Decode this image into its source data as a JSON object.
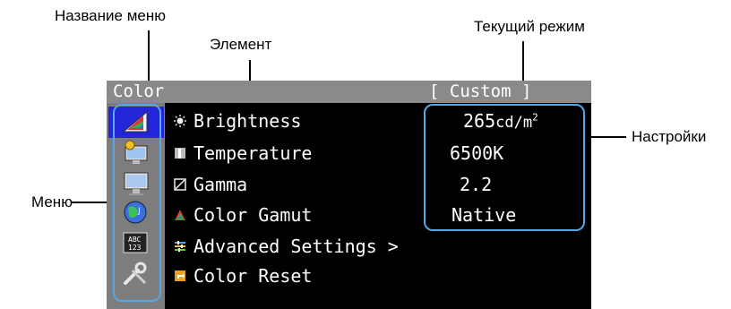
{
  "callouts": {
    "menu_name": "Название меню",
    "element": "Элемент",
    "current_mode": "Текущий режим",
    "settings": "Настройки",
    "menu": "Меню"
  },
  "osd": {
    "title": "Color",
    "mode": "[  Custom  ]",
    "items": [
      {
        "label": "Brightness",
        "icon": "brightness-icon"
      },
      {
        "label": "Temperature",
        "icon": "temperature-icon"
      },
      {
        "label": "Gamma",
        "icon": "gamma-icon"
      },
      {
        "label": "Color Gamut",
        "icon": "color-gamut-icon"
      },
      {
        "label": "Advanced Settings >",
        "icon": "advanced-settings-icon"
      },
      {
        "label": "Color Reset",
        "icon": "color-reset-icon"
      }
    ],
    "values": {
      "brightness": "265",
      "brightness_unit": "cd/m",
      "brightness_unit_exp": "2",
      "temperature": "6500K",
      "gamma": "2.2",
      "gamut": "Native"
    },
    "menu_icons": [
      "color-icon",
      "signal-icon",
      "monitor-settings-icon",
      "language-icon",
      "info-icon",
      "tools-icon"
    ]
  },
  "colors": {
    "highlight": "#55a8e8",
    "osd_bg": "#000000",
    "title_bar": "#8a8a8a",
    "icon_bar": "#7d7d7d",
    "active_icon": "#2424d8"
  }
}
